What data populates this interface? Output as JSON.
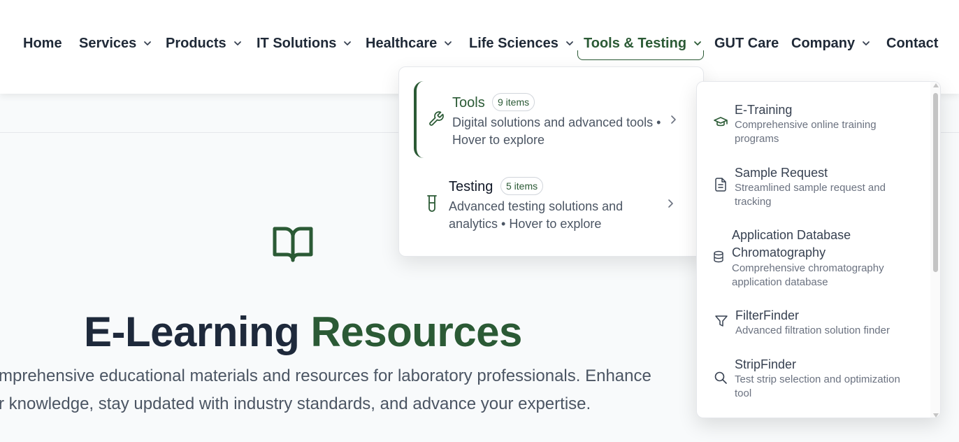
{
  "nav": {
    "items": [
      {
        "label": "Home"
      },
      {
        "label": "Services"
      },
      {
        "label": "Products"
      },
      {
        "label": "IT Solutions"
      },
      {
        "label": "Healthcare"
      },
      {
        "label": "Life Sciences"
      },
      {
        "label": "Tools & Testing"
      },
      {
        "label": "GUT Care"
      },
      {
        "label": "Company"
      },
      {
        "label": "Contact"
      }
    ],
    "active": "Tools & Testing"
  },
  "hero": {
    "title_part1": "E-Learning",
    "title_part2": "Resources",
    "subtitle_line1": "mprehensive educational materials and resources for laboratory professionals. Enhance",
    "subtitle_line2": "r knowledge, stay updated with industry standards, and advance your expertise.",
    "icon": "book-open-icon"
  },
  "dropdown": {
    "categories": [
      {
        "title": "Tools",
        "badge": "9 items",
        "description": "Digital solutions and advanced tools • Hover to explore",
        "icon": "wrench-icon"
      },
      {
        "title": "Testing",
        "badge": "5 items",
        "description": "Advanced testing solutions and analytics • Hover to explore",
        "icon": "test-tube-icon"
      }
    ]
  },
  "submenu": {
    "items": [
      {
        "title": "E-Training",
        "description": "Comprehensive online training programs",
        "icon": "graduation-cap-icon"
      },
      {
        "title": "Sample Request",
        "description": "Streamlined sample request and tracking",
        "icon": "file-text-icon"
      },
      {
        "title": "Application Database Chromatography",
        "description": "Comprehensive chromatography application database",
        "icon": "database-icon"
      },
      {
        "title": "FilterFinder",
        "description": "Advanced filtration solution finder",
        "icon": "filter-icon"
      },
      {
        "title": "StripFinder",
        "description": "Test strip selection and optimization tool",
        "icon": "search-icon"
      }
    ]
  },
  "colors": {
    "accent": "#2b5a35",
    "text": "#1e293b",
    "muted": "#4b5563"
  }
}
